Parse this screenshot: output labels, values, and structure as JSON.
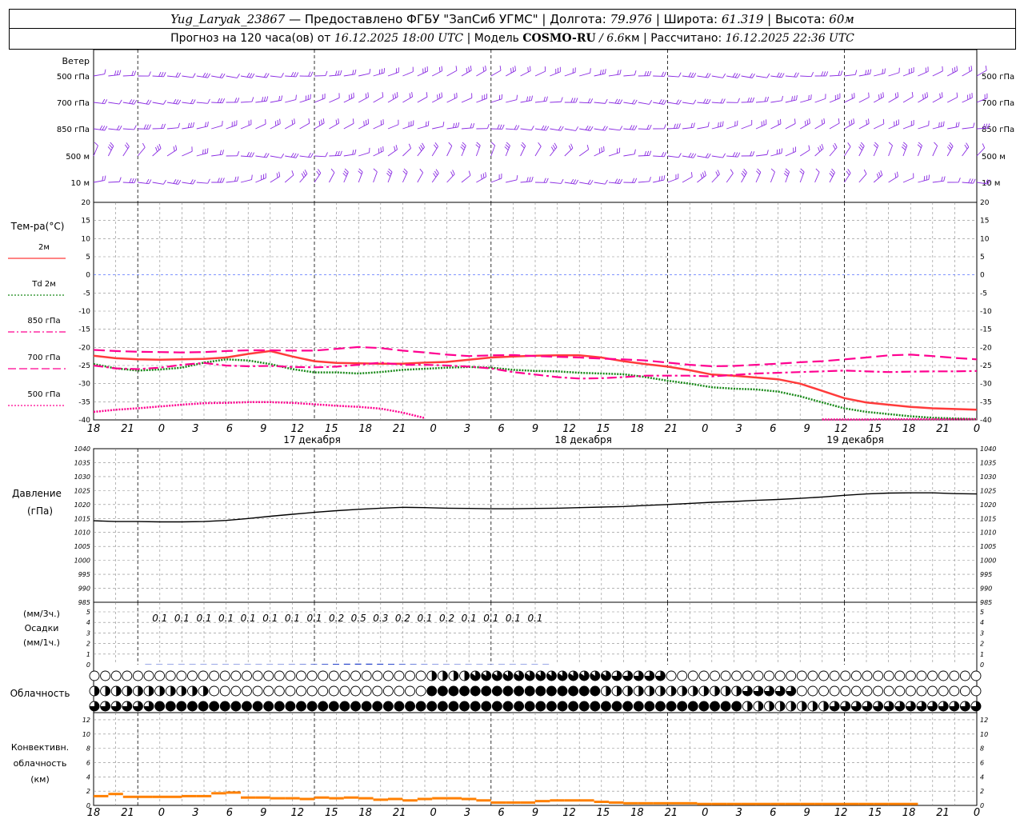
{
  "header": {
    "station": "Yug_Laryak_23867",
    "provided_by": " — Предоставлено ФГБУ \"ЗапСиб УГМС\" | Долгота: ",
    "lon": "79.976",
    "lat_label": " | Широта: ",
    "lat": "61.319",
    "alt_label": " | Высота: ",
    "alt": "60м",
    "forecast_label": "Прогноз на 120 часа(ов) от ",
    "forecast_time": "16.12.2025 18:00 UTC",
    "model_label": "  | Модель ",
    "model": "COSMO-RU",
    "resolution": " / 6.6",
    "res_unit": "км",
    "calc_label": " | Рассчитано: ",
    "calc_time": "16.12.2025 22:36 UTC"
  },
  "wind_panel": {
    "title": "Ветер",
    "levels": [
      "500 гПа",
      "700 гПа",
      "850 гПа",
      "500  м",
      "10  м"
    ]
  },
  "temp_panel": {
    "title": "Тем-ра(°C)",
    "legend": [
      {
        "label": "2м",
        "color": "#ff3b3b",
        "style": "solid"
      },
      {
        "label": "Td  2м",
        "color": "#1a8a1a",
        "style": "dotted"
      },
      {
        "label": "850 гПа",
        "color": "#ff0090",
        "style": "dashdot"
      },
      {
        "label": "700 гПа",
        "color": "#ff0090",
        "style": "longdash"
      },
      {
        "label": "500 гПа",
        "color": "#ff0090",
        "style": "dotted"
      }
    ],
    "ticks": [
      "20",
      "15",
      "10",
      "5",
      "0",
      "-5",
      "-10",
      "-15",
      "-20",
      "-25",
      "-30",
      "-35",
      "-40"
    ]
  },
  "pressure_panel": {
    "title1": "Давление",
    "title2": "(гПа)",
    "ticks": [
      "1040",
      "1035",
      "1030",
      "1025",
      "1020",
      "1015",
      "1010",
      "1005",
      "1000",
      "995",
      "990",
      "985"
    ]
  },
  "precip_panel": {
    "label1": "(мм/3ч.)",
    "label2": "Осадки",
    "label3": "(мм/1ч.)",
    "ticks": [
      "5",
      "4",
      "3",
      "2",
      "1",
      "0"
    ],
    "amounts": [
      "0.1",
      "0.1",
      "0.1",
      "0.1",
      "0.1",
      "0.1",
      "0.1",
      "0.1",
      "0.2",
      "0.5",
      "0.3",
      "0.2",
      "0.1",
      "0.2",
      "0.1",
      "0.1",
      "0.1",
      "0.1"
    ]
  },
  "cloud_panel": {
    "title": "Облачность"
  },
  "conv_panel": {
    "title1": "Конвективн.",
    "title2": "облачность",
    "title3": "(км)",
    "ticks": [
      "12",
      "10",
      "8",
      "6",
      "4",
      "2",
      "0"
    ]
  },
  "time_axis": {
    "hour_labels": [
      "18",
      "21",
      "0",
      "3",
      "6",
      "9",
      "12",
      "15",
      "18",
      "21",
      "0",
      "3",
      "6",
      "9",
      "12",
      "15",
      "18",
      "21",
      "0",
      "3",
      "6",
      "9",
      "12",
      "15",
      "18",
      "21",
      "0"
    ],
    "dates": [
      "17 декабря",
      "18 декабря",
      "19 декабря"
    ]
  },
  "chart_data": {
    "type": "line",
    "x_unit": "hours from 16.12.2025 18:00 UTC",
    "x": [
      0,
      3,
      6,
      9,
      12,
      15,
      18,
      21,
      24,
      27,
      30,
      33,
      36,
      39,
      42,
      45,
      48,
      51,
      54,
      57,
      60,
      63,
      66,
      69,
      72,
      75,
      78,
      81,
      84,
      87,
      90,
      93,
      96,
      99,
      102,
      105,
      108,
      111,
      114,
      117,
      120
    ],
    "temperature": {
      "ylim": [
        -40,
        20
      ],
      "series": [
        {
          "name": "2м",
          "values": [
            -22.3,
            -23.0,
            -23.3,
            -23.4,
            -23.3,
            -23.2,
            -22.8,
            -21.8,
            -21.0,
            -22.5,
            -23.8,
            -24.3,
            -24.4,
            -24.5,
            -24.5,
            -24.2,
            -24.0,
            -23.4,
            -22.8,
            -22.5,
            -22.3,
            -22.2,
            -22.2,
            -22.8,
            -23.8,
            -24.6,
            -25.3,
            -26.3,
            -27.5,
            -27.8,
            -28.3,
            -28.8,
            -30.0,
            -32.0,
            -34.0,
            -35.2,
            -35.8,
            -36.4,
            -36.8,
            -37.0,
            -37.2
          ]
        },
        {
          "name": "Td  2м",
          "values": [
            -24.6,
            -25.8,
            -26.4,
            -26.1,
            -25.6,
            -24.2,
            -23.3,
            -23.6,
            -24.6,
            -26.0,
            -26.9,
            -26.9,
            -27.2,
            -26.8,
            -26.2,
            -25.9,
            -25.6,
            -25.4,
            -25.6,
            -26.2,
            -26.5,
            -26.6,
            -27.0,
            -27.2,
            -27.4,
            -28.2,
            -29.2,
            -30.0,
            -31.0,
            -31.4,
            -31.6,
            -32.2,
            -33.5,
            -35.2,
            -36.8,
            -37.8,
            -38.4,
            -39.0,
            -39.4,
            -39.6,
            -39.8
          ]
        },
        {
          "name": "850 гПа",
          "values": [
            -25.0,
            -25.8,
            -26.0,
            -25.6,
            -24.8,
            -24.3,
            -25.0,
            -25.2,
            -25.1,
            -25.4,
            -25.5,
            -25.3,
            -24.8,
            -24.2,
            -24.8,
            -24.8,
            -25.0,
            -25.3,
            -25.8,
            -26.8,
            -27.5,
            -28.2,
            -28.6,
            -28.5,
            -28.2,
            -27.8,
            -27.8,
            -27.8,
            -28.0,
            -27.6,
            -27.2,
            -27.0,
            -26.8,
            -26.6,
            -26.4,
            -26.6,
            -26.8,
            -26.7,
            -26.6,
            -26.6,
            -26.5
          ]
        },
        {
          "name": "700 гПа",
          "values": [
            -20.7,
            -21.0,
            -21.2,
            -21.3,
            -21.4,
            -21.3,
            -21.0,
            -20.8,
            -20.8,
            -20.9,
            -20.9,
            -20.4,
            -19.9,
            -20.2,
            -20.9,
            -21.4,
            -22.0,
            -22.4,
            -22.2,
            -22.1,
            -22.4,
            -22.6,
            -22.8,
            -23.1,
            -23.3,
            -23.6,
            -24.2,
            -24.8,
            -25.2,
            -25.1,
            -24.8,
            -24.5,
            -24.1,
            -23.8,
            -23.3,
            -22.8,
            -22.2,
            -22.0,
            -22.4,
            -22.9,
            -23.3
          ]
        },
        {
          "name": "500 гПа",
          "values": [
            -37.8,
            -37.2,
            -36.8,
            -36.3,
            -35.8,
            -35.4,
            -35.3,
            -35.1,
            -35.1,
            -35.3,
            -35.7,
            -36.1,
            -36.4,
            -36.9,
            -38.0,
            -39.5,
            null,
            null,
            null,
            null,
            null,
            null,
            null,
            null,
            null,
            null,
            null,
            null,
            null,
            null,
            null,
            null,
            null,
            -39.9,
            -39.9,
            -39.9,
            -39.8,
            -39.8,
            -39.8,
            -39.8,
            -39.8
          ]
        }
      ]
    },
    "pressure": {
      "ylim": [
        985,
        1040
      ],
      "values": [
        1014.2,
        1013.9,
        1013.9,
        1013.8,
        1013.8,
        1013.9,
        1014.3,
        1015.0,
        1015.8,
        1016.5,
        1017.2,
        1017.8,
        1018.3,
        1018.7,
        1019.0,
        1018.9,
        1018.7,
        1018.6,
        1018.5,
        1018.5,
        1018.6,
        1018.7,
        1018.9,
        1019.1,
        1019.3,
        1019.7,
        1020.0,
        1020.4,
        1020.8,
        1021.1,
        1021.5,
        1021.8,
        1022.2,
        1022.7,
        1023.3,
        1023.8,
        1024.1,
        1024.2,
        1024.2,
        1023.9,
        1023.8
      ]
    },
    "precip_3h": {
      "x": [
        9,
        12,
        15,
        18,
        21,
        24,
        27,
        30,
        33,
        36,
        39,
        42,
        45,
        48,
        51,
        54,
        57,
        60
      ],
      "values": [
        0.1,
        0.1,
        0.1,
        0.1,
        0.1,
        0.1,
        0.1,
        0.1,
        0.2,
        0.5,
        0.3,
        0.2,
        0.1,
        0.2,
        0.1,
        0.1,
        0.1,
        0.1
      ]
    },
    "conv_cloud_km": {
      "ylim": [
        0,
        13
      ],
      "values": [
        1.3,
        1.6,
        1.2,
        1.2,
        1.2,
        1.2,
        1.3,
        1.3,
        1.7,
        1.8,
        1.1,
        1.1,
        1.0,
        1.0,
        0.9,
        1.1,
        1.0,
        1.1,
        1.0,
        0.8,
        0.9,
        0.7,
        0.9,
        1.0,
        1.0,
        0.9,
        0.7,
        0.4,
        0.4,
        0.4,
        0.6,
        0.7,
        0.7,
        0.7,
        0.5,
        0.4,
        0.3,
        0.3,
        0.3,
        0.3,
        0.3,
        0.2,
        0.2,
        0.2,
        0.2,
        0.2,
        0.2,
        0.2,
        0.2,
        0.2,
        0.2,
        0.2,
        0.2,
        0.2,
        0.2,
        0.2,
        null,
        null,
        null,
        null,
        null
      ]
    }
  }
}
